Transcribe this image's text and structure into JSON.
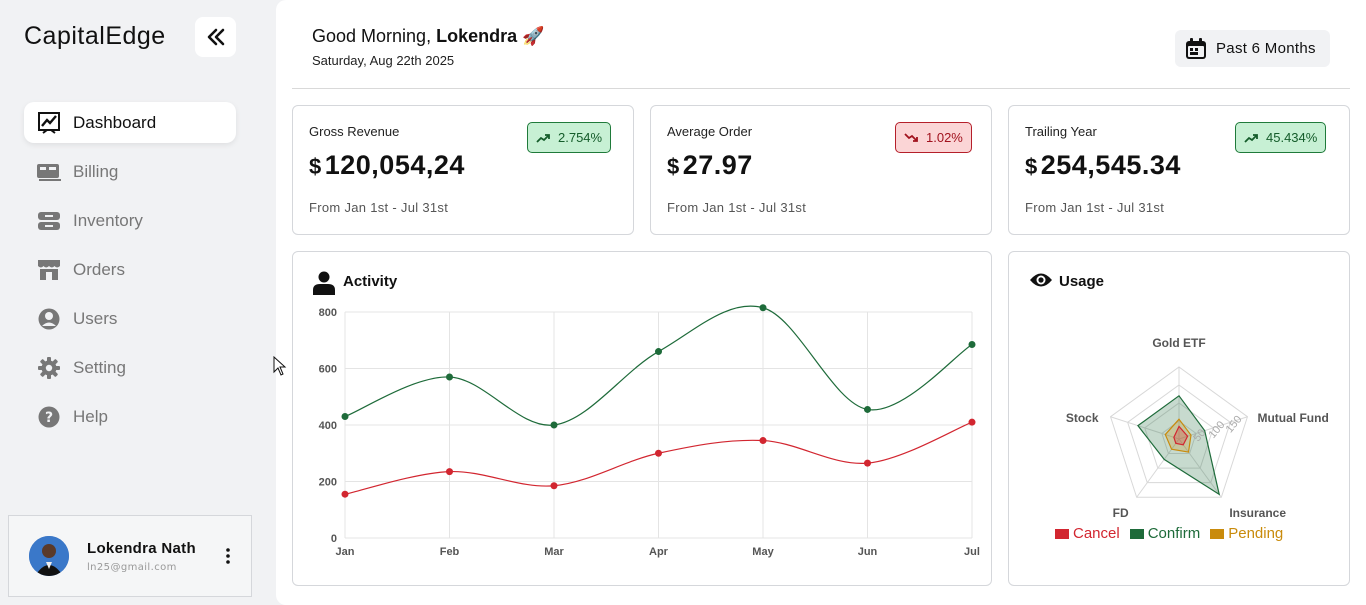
{
  "app": {
    "brand": "CapitalEdge"
  },
  "sidebar": {
    "items": [
      {
        "label": "Dashboard",
        "icon": "chart-icon",
        "active": true
      },
      {
        "label": "Billing",
        "icon": "billing-icon"
      },
      {
        "label": "Inventory",
        "icon": "inventory-icon"
      },
      {
        "label": "Orders",
        "icon": "store-icon"
      },
      {
        "label": "Users",
        "icon": "user-circle-icon"
      },
      {
        "label": "Setting",
        "icon": "gear-icon"
      },
      {
        "label": "Help",
        "icon": "help-icon"
      }
    ],
    "user": {
      "name": "Lokendra Nath",
      "email": "ln25@gmail.com"
    }
  },
  "header": {
    "greeting_prefix": "Good Morning,",
    "greeting_name": "Lokendra",
    "greeting_emoji": "🚀",
    "date": "Saturday, Aug 22th 2025",
    "period_label": "Past 6 Months"
  },
  "stats": [
    {
      "label": "Gross Revenue",
      "currency": "$",
      "value": "120,054,24",
      "range": "From Jan 1st - Jul 31st",
      "change": "2.754%",
      "trend": "up"
    },
    {
      "label": "Average Order",
      "currency": "$",
      "value": "27.97",
      "range": "From Jan 1st - Jul 31st",
      "change": "1.02%",
      "trend": "down"
    },
    {
      "label": "Trailing Year",
      "currency": "$",
      "value": "254,545.34",
      "range": "From Jan 1st - Jul 31st",
      "change": "45.434%",
      "trend": "up"
    }
  ],
  "colors": {
    "green": "#1e6b3a",
    "red": "#d22630",
    "amber": "#c98b0c"
  },
  "activity": {
    "title": "Activity",
    "chart_data": {
      "type": "line",
      "categories": [
        "Jan",
        "Feb",
        "Mar",
        "Apr",
        "May",
        "Jun",
        "Jul"
      ],
      "series": [
        {
          "color": "#1e6b3a",
          "values": [
            430,
            570,
            400,
            660,
            815,
            455,
            685
          ]
        },
        {
          "color": "#d22630",
          "values": [
            155,
            235,
            185,
            300,
            345,
            265,
            410
          ]
        }
      ],
      "ylim": [
        0,
        800
      ],
      "yticks": [
        0,
        200,
        400,
        600,
        800
      ],
      "grid": true
    }
  },
  "usage": {
    "title": "Usage",
    "chart_data": {
      "type": "radar",
      "axes": [
        "Gold ETF",
        "Mutual Fund",
        "Insurance",
        "FD",
        "Stock"
      ],
      "rticks": [
        50,
        100,
        150
      ],
      "rmax": 200,
      "series": [
        {
          "name": "Confirm",
          "color": "#1e6b3a",
          "values": [
            120,
            75,
            190,
            70,
            120
          ]
        },
        {
          "name": "Pending",
          "color": "#c98b0c",
          "values": [
            55,
            35,
            45,
            35,
            40
          ]
        },
        {
          "name": "Cancel",
          "color": "#d22630",
          "values": [
            35,
            25,
            20,
            15,
            15
          ]
        }
      ],
      "legend": [
        "Cancel",
        "Confirm",
        "Pending"
      ]
    }
  }
}
